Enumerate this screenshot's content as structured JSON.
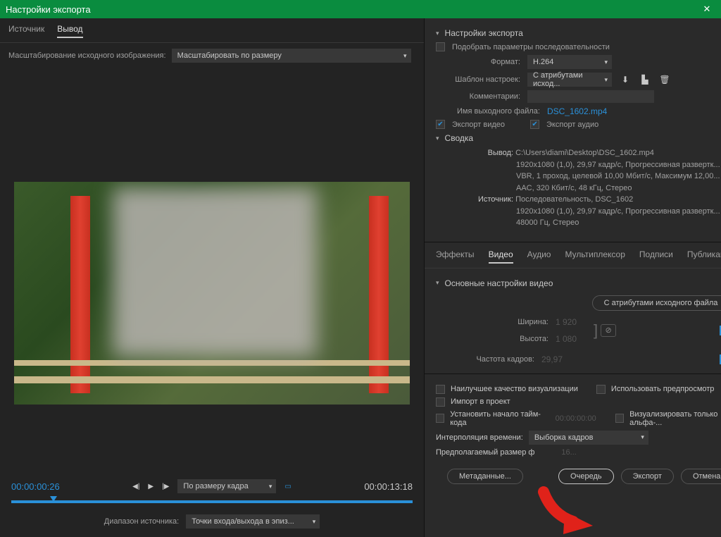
{
  "title": "Настройки экспорта",
  "left": {
    "tabs": [
      "Источник",
      "Вывод"
    ],
    "scale_label": "Масштабирование исходного изображения:",
    "scale_value": "Масштабировать по размеру",
    "tc_in": "00:00:00:26",
    "tc_out": "00:00:13:18",
    "fit_label": "По размеру кадра",
    "source_range_label": "Диапазон источника:",
    "source_range_value": "Точки входа/выхода в эпиз..."
  },
  "export": {
    "section_title": "Настройки экспорта",
    "match_seq": "Подобрать параметры последовательности",
    "format_label": "Формат:",
    "format_value": "H.264",
    "preset_label": "Шаблон настроек:",
    "preset_value": "С атрибутами исход...",
    "comments_label": "Комментарии:",
    "output_name_label": "Имя выходного файла:",
    "output_name": "DSC_1602.mp4",
    "export_video": "Экспорт видео",
    "export_audio": "Экспорт аудио"
  },
  "summary": {
    "title": "Сводка",
    "output_label": "Вывод:",
    "output_line1": "C:\\Users\\diami\\Desktop\\DSC_1602.mp4",
    "output_line2": "1920x1080 (1,0), 29,97 кадр/с, Прогрессивная развертк...",
    "output_line3": "VBR, 1 проход, целевой 10,00 Мбит/с, Максимум 12,00...",
    "output_line4": "AAC, 320 Кбит/с, 48 кГц, Стерео",
    "source_label": "Источник:",
    "source_line1": "Последовательность, DSC_1602",
    "source_line2": "1920x1080 (1,0), 29,97 кадр/с, Прогрессивная развертк...",
    "source_line3": "48000 Гц, Стерео"
  },
  "rtabs": [
    "Эффекты",
    "Видео",
    "Аудио",
    "Мультиплексор",
    "Подписи",
    "Публикац"
  ],
  "video": {
    "section_title": "Основные настройки видео",
    "match_btn": "С атрибутами исходного файла",
    "width_label": "Ширина:",
    "width_val": "1 920",
    "height_label": "Высота:",
    "height_val": "1 080",
    "fps_label": "Частота кадров:",
    "fps_val": "29,97"
  },
  "bottom": {
    "best_quality": "Наилучшее качество визуализации",
    "use_preview": "Использовать предпросмотр",
    "import": "Импорт в проект",
    "set_tc": "Установить начало тайм-кода",
    "tc_val": "00:00:00:00",
    "alpha_only": "Визуализировать только альфа-...",
    "interp_label": "Интерполяция времени:",
    "interp_val": "Выборка кадров",
    "est_label": "Предполагаемый размер ф",
    "est_val": "16...",
    "metadata": "Метаданные...",
    "queue": "Очередь",
    "export_btn": "Экспорт",
    "cancel": "Отмена"
  }
}
